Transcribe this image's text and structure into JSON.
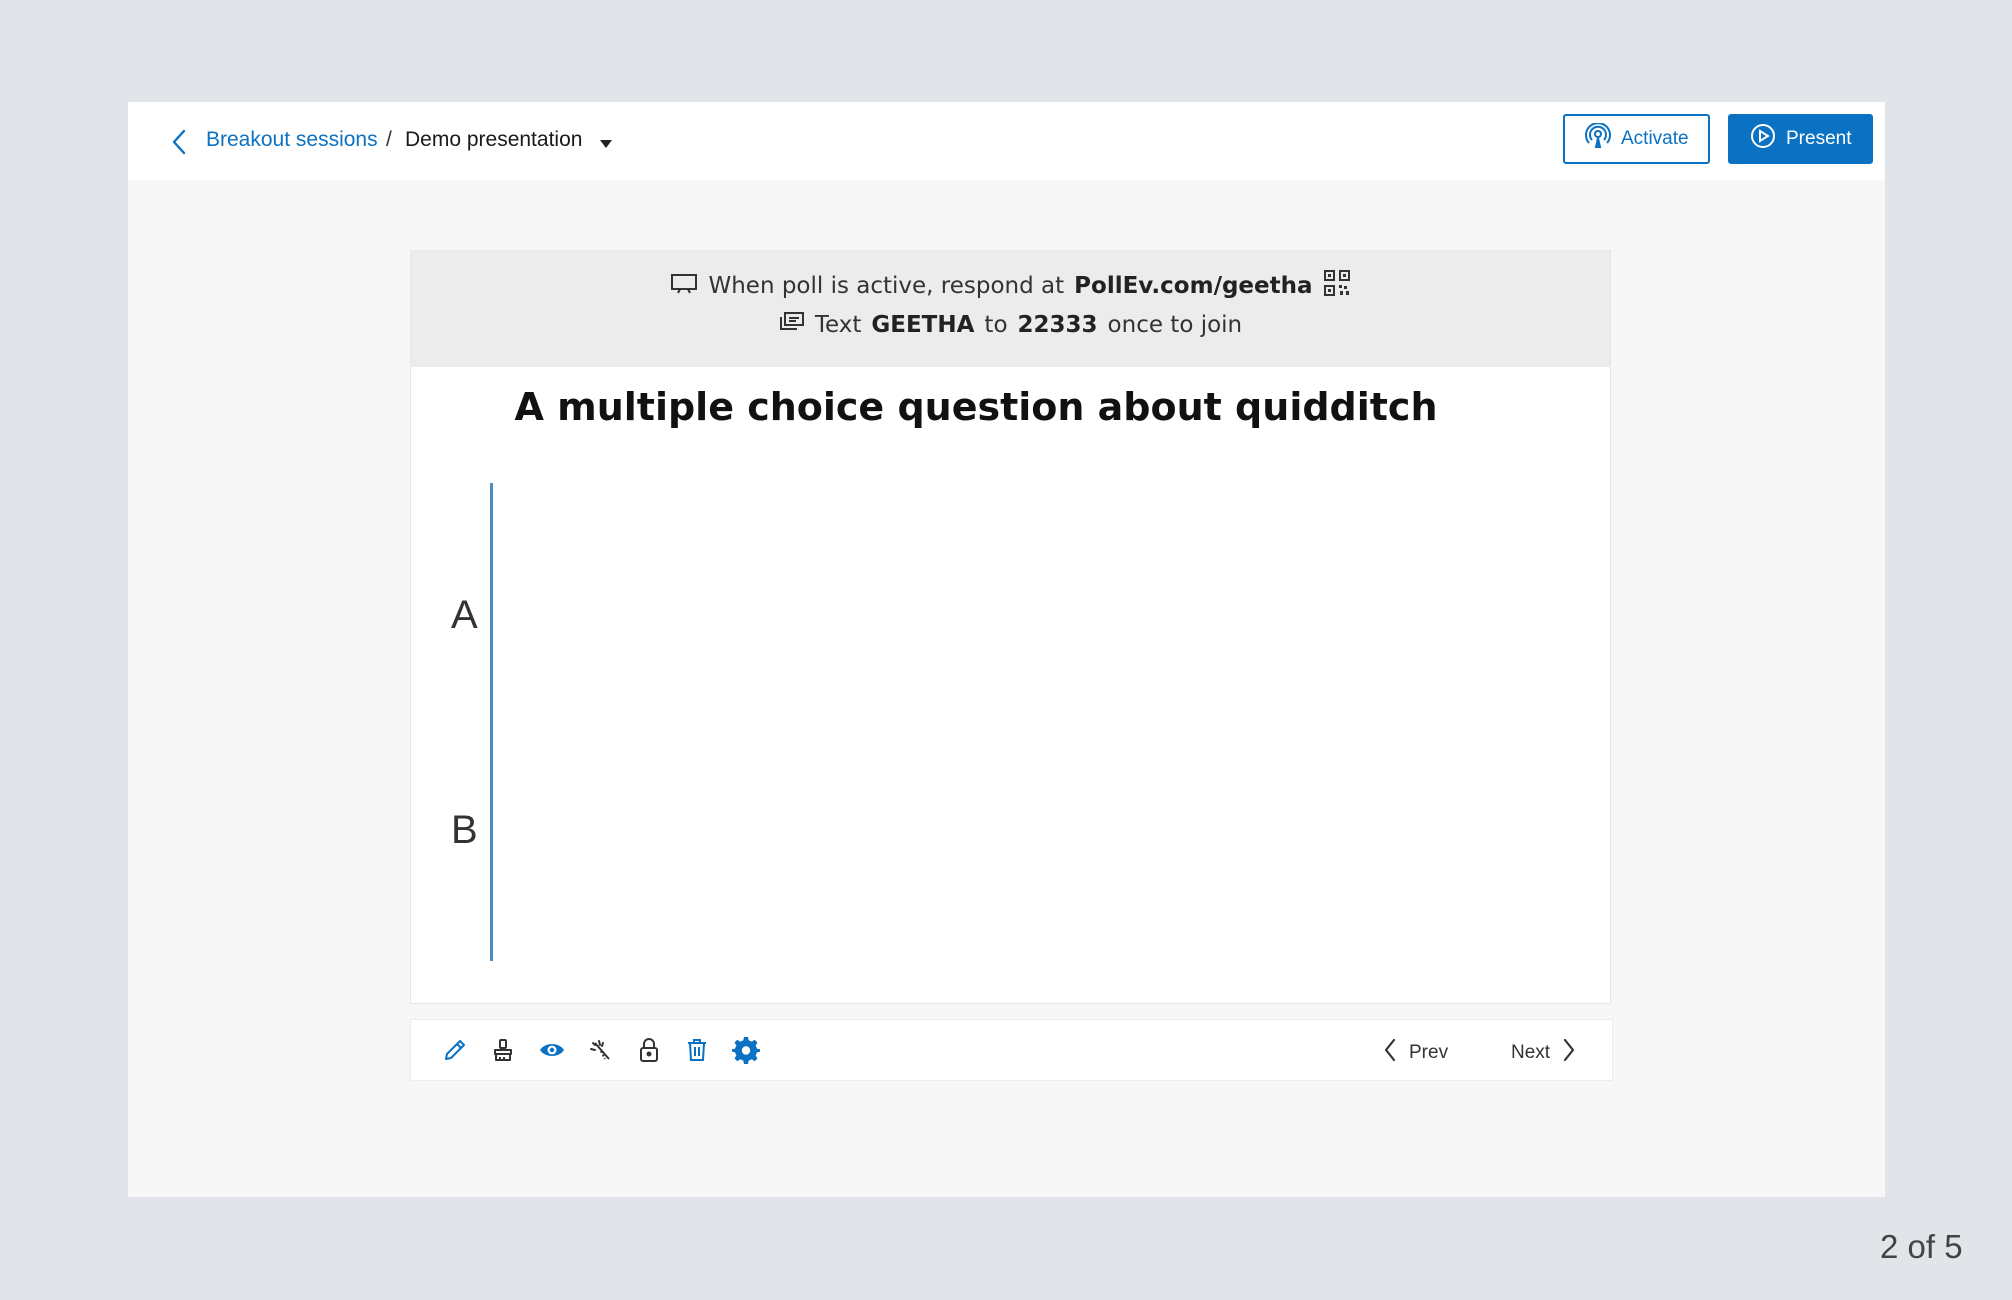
{
  "breadcrumb": {
    "parent": "Breakout sessions",
    "separator": "/",
    "current": "Demo presentation"
  },
  "buttons": {
    "activate": "Activate",
    "present": "Present"
  },
  "banner": {
    "respond_prefix": "When poll is active, respond at",
    "respond_url": "PollEv.com/geetha",
    "text_prefix": "Text",
    "text_keyword": "GEETHA",
    "text_to": "to",
    "text_number": "22333",
    "text_suffix": "once to join"
  },
  "question": {
    "title": "A multiple choice question about quidditch"
  },
  "chart_data": {
    "type": "bar",
    "categories": [
      "A",
      "B"
    ],
    "values": [
      0,
      0
    ],
    "orientation": "horizontal"
  },
  "toolbar": {
    "tools": [
      "pencil-icon",
      "brush-icon",
      "eye-icon",
      "wand-icon",
      "lock-icon",
      "trash-icon",
      "gear-icon"
    ],
    "prev": "Prev",
    "next": "Next"
  },
  "pagination": "2 of 5",
  "colors": {
    "accent": "#0b72c3",
    "axis": "#4a8cc4"
  }
}
